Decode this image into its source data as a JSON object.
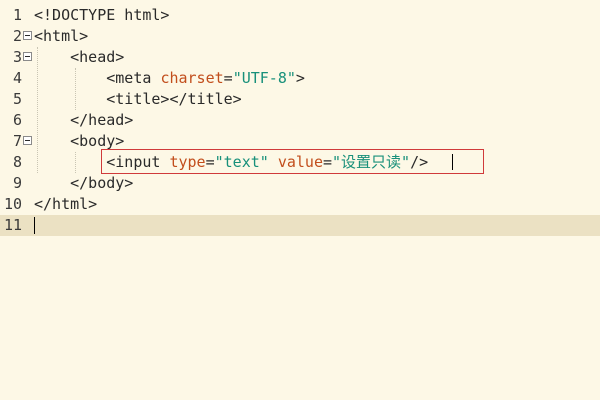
{
  "editor": {
    "language": "html",
    "lines": [
      {
        "num": "1",
        "tokens": [
          {
            "t": "<!DOCTYPE html>",
            "c": "text"
          }
        ]
      },
      {
        "num": "2",
        "fold": true,
        "tokens": [
          {
            "t": "<html>",
            "c": "tag"
          }
        ]
      },
      {
        "num": "3",
        "fold": true,
        "tokens": [
          {
            "t": "    <head>",
            "c": "tag"
          }
        ]
      },
      {
        "num": "4",
        "tokens": [
          {
            "t": "        <meta ",
            "c": "tag"
          },
          {
            "t": "charset",
            "c": "attr"
          },
          {
            "t": "=",
            "c": "text"
          },
          {
            "t": "\"UTF-8\"",
            "c": "val"
          },
          {
            "t": ">",
            "c": "tag"
          }
        ]
      },
      {
        "num": "5",
        "tokens": [
          {
            "t": "        <title></title>",
            "c": "tag"
          }
        ]
      },
      {
        "num": "6",
        "tokens": [
          {
            "t": "    </head>",
            "c": "tag"
          }
        ]
      },
      {
        "num": "7",
        "fold": true,
        "tokens": [
          {
            "t": "    <body>",
            "c": "tag"
          }
        ]
      },
      {
        "num": "8",
        "tokens": [
          {
            "t": "        <input ",
            "c": "tag"
          },
          {
            "t": "type",
            "c": "attr"
          },
          {
            "t": "=",
            "c": "text"
          },
          {
            "t": "\"text\"",
            "c": "val"
          },
          {
            "t": " ",
            "c": "text"
          },
          {
            "t": "value",
            "c": "attr"
          },
          {
            "t": "=",
            "c": "text"
          },
          {
            "t": "\"设置只读\"",
            "c": "val"
          },
          {
            "t": "/>",
            "c": "tag"
          }
        ]
      },
      {
        "num": "9",
        "tokens": [
          {
            "t": "    </body>",
            "c": "tag"
          }
        ]
      },
      {
        "num": "10",
        "tokens": [
          {
            "t": "</html>",
            "c": "tag"
          }
        ]
      },
      {
        "num": "11",
        "current": true,
        "tokens": []
      }
    ]
  },
  "colors": {
    "background": "#fdf8e6",
    "current_line": "#ebe1c3",
    "attribute": "#c24e1c",
    "string": "#18907a",
    "highlight_border": "#d03a3a"
  }
}
